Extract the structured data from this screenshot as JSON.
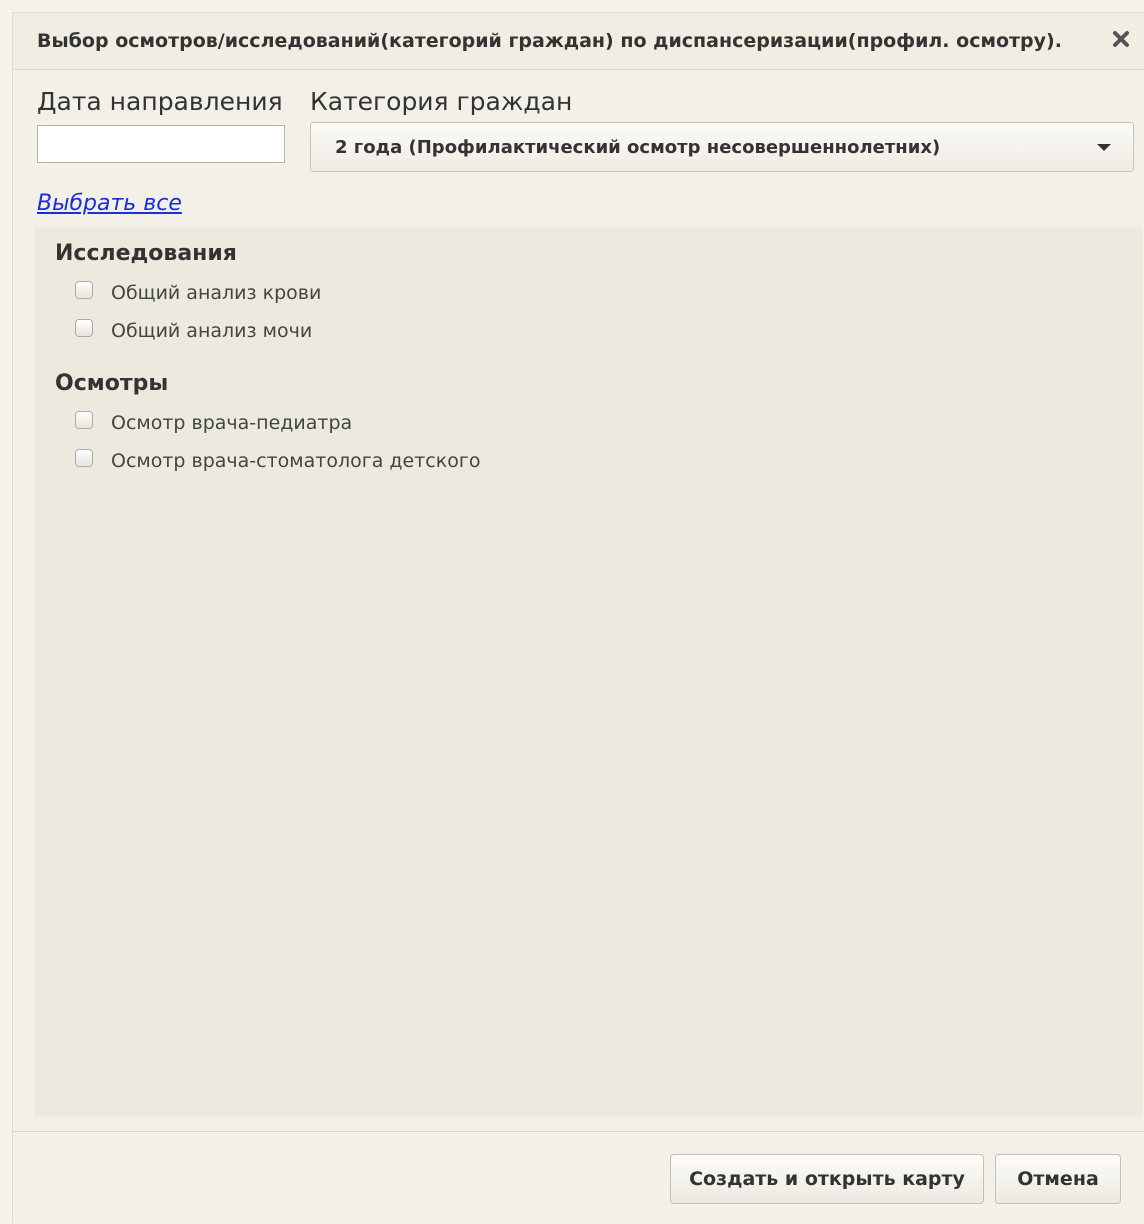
{
  "dialog": {
    "title": "Выбор осмотров/исследований(категорий граждан) по диспансеризации(профил. осмотру).",
    "close_icon": "close-icon"
  },
  "form": {
    "date_label": "Дата направления",
    "date_value": "",
    "category_label": "Категория граждан",
    "category_value": "2 года (Профилактический осмотр несовершеннолетних)"
  },
  "select_all_link": "Выбрать все",
  "groups": [
    {
      "title": "Исследования",
      "items": [
        {
          "label": "Общий анализ крови",
          "checked": false
        },
        {
          "label": "Общий анализ мочи",
          "checked": false
        }
      ]
    },
    {
      "title": "Осмотры",
      "items": [
        {
          "label": "Осмотр врача-педиатра",
          "checked": false
        },
        {
          "label": "Осмотр врача-стоматолога детского",
          "checked": false
        }
      ]
    }
  ],
  "buttons": {
    "create": "Создать и открыть карту",
    "cancel": "Отмена"
  },
  "colors": {
    "link": "#1a2fd6",
    "background": "#f3f0e8",
    "panel": "#ece9df"
  }
}
